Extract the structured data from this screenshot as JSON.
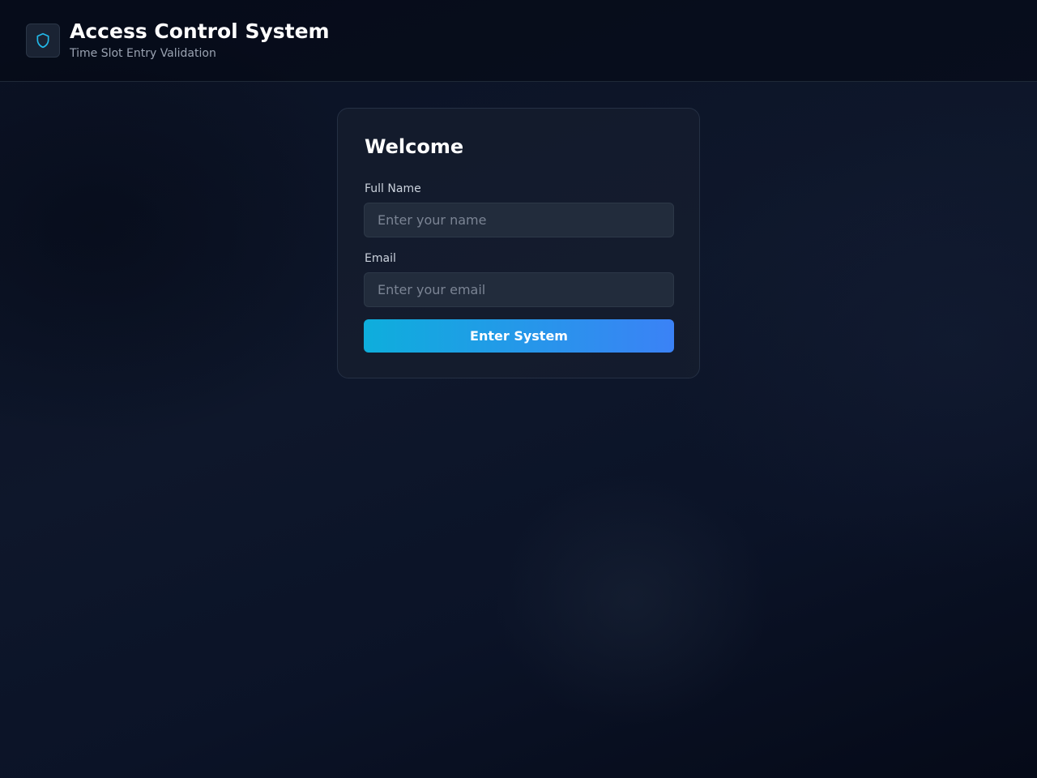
{
  "header": {
    "logo_icon": "shield-icon",
    "title": "Access Control System",
    "subtitle": "Time Slot Entry Validation"
  },
  "login_card": {
    "title": "Welcome",
    "fields": {
      "name": {
        "label": "Full Name",
        "value": "",
        "placeholder": "Enter your name"
      },
      "email": {
        "label": "Email",
        "value": "",
        "placeholder": "Enter your email"
      }
    },
    "submit_label": "Enter System"
  },
  "colors": {
    "accent_start": "#0eaedc",
    "accent_end": "#3b82f6",
    "background": "#0e172b",
    "card": "#161e2e",
    "icon": "#22b8e8"
  }
}
